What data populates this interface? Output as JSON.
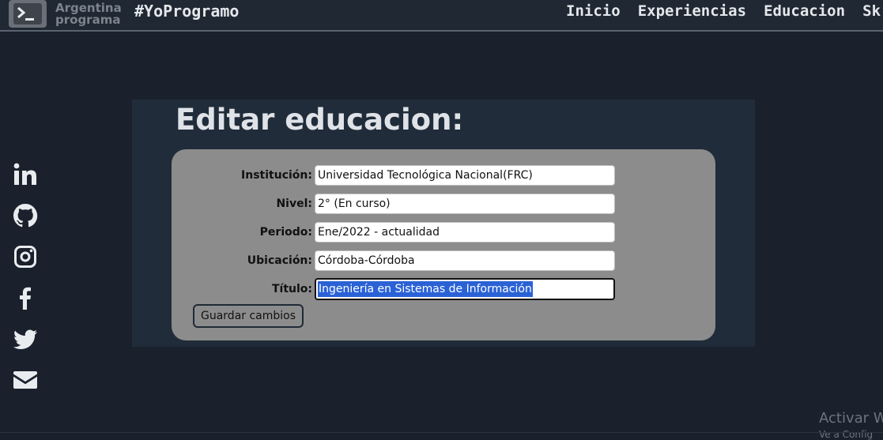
{
  "header": {
    "logo_icon": "terminal-icon",
    "brand_line1": "Argentina",
    "brand_line2": "programa",
    "site_title": "#YoProgramo",
    "nav": [
      "Inicio",
      "Experiencias",
      "Educacion",
      "Sk"
    ]
  },
  "social": [
    "linkedin-icon",
    "github-icon",
    "instagram-icon",
    "facebook-icon",
    "twitter-icon",
    "envelope-icon"
  ],
  "panel": {
    "title": "Editar educacion:",
    "fields": [
      {
        "label": "Institución:",
        "value": "Universidad Tecnológica Nacional(FRC)"
      },
      {
        "label": "Nivel:",
        "value": "2° (En curso)"
      },
      {
        "label": "Periodo:",
        "value": "Ene/2022 - actualidad"
      },
      {
        "label": "Ubicación:",
        "value": "Córdoba-Córdoba"
      },
      {
        "label": "Título:",
        "value": "Ingeniería en Sistemas de Información"
      }
    ],
    "save_label": "Guardar cambios"
  },
  "watermark": {
    "line1": "Activar W",
    "line2": "Ve a Config"
  },
  "colors": {
    "background": "#1a212c",
    "panel": "#202c3a",
    "form": "#8c8c8c",
    "selection": "#2a62d6"
  }
}
